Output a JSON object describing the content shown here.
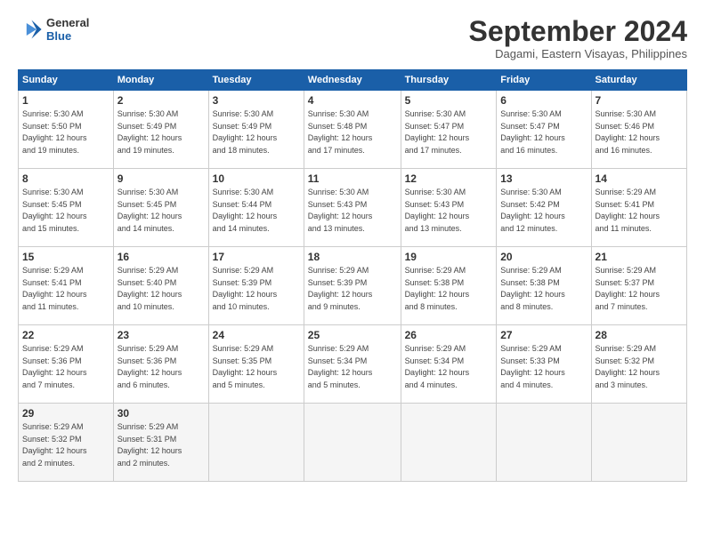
{
  "header": {
    "logo_line1": "General",
    "logo_line2": "Blue",
    "month_title": "September 2024",
    "location": "Dagami, Eastern Visayas, Philippines"
  },
  "weekdays": [
    "Sunday",
    "Monday",
    "Tuesday",
    "Wednesday",
    "Thursday",
    "Friday",
    "Saturday"
  ],
  "weeks": [
    [
      {
        "day": "1",
        "sunrise": "5:30 AM",
        "sunset": "5:50 PM",
        "daylight": "12 hours and 19 minutes."
      },
      {
        "day": "2",
        "sunrise": "5:30 AM",
        "sunset": "5:49 PM",
        "daylight": "12 hours and 19 minutes."
      },
      {
        "day": "3",
        "sunrise": "5:30 AM",
        "sunset": "5:49 PM",
        "daylight": "12 hours and 18 minutes."
      },
      {
        "day": "4",
        "sunrise": "5:30 AM",
        "sunset": "5:48 PM",
        "daylight": "12 hours and 17 minutes."
      },
      {
        "day": "5",
        "sunrise": "5:30 AM",
        "sunset": "5:47 PM",
        "daylight": "12 hours and 17 minutes."
      },
      {
        "day": "6",
        "sunrise": "5:30 AM",
        "sunset": "5:47 PM",
        "daylight": "12 hours and 16 minutes."
      },
      {
        "day": "7",
        "sunrise": "5:30 AM",
        "sunset": "5:46 PM",
        "daylight": "12 hours and 16 minutes."
      }
    ],
    [
      {
        "day": "8",
        "sunrise": "5:30 AM",
        "sunset": "5:45 PM",
        "daylight": "12 hours and 15 minutes."
      },
      {
        "day": "9",
        "sunrise": "5:30 AM",
        "sunset": "5:45 PM",
        "daylight": "12 hours and 14 minutes."
      },
      {
        "day": "10",
        "sunrise": "5:30 AM",
        "sunset": "5:44 PM",
        "daylight": "12 hours and 14 minutes."
      },
      {
        "day": "11",
        "sunrise": "5:30 AM",
        "sunset": "5:43 PM",
        "daylight": "12 hours and 13 minutes."
      },
      {
        "day": "12",
        "sunrise": "5:30 AM",
        "sunset": "5:43 PM",
        "daylight": "12 hours and 13 minutes."
      },
      {
        "day": "13",
        "sunrise": "5:30 AM",
        "sunset": "5:42 PM",
        "daylight": "12 hours and 12 minutes."
      },
      {
        "day": "14",
        "sunrise": "5:29 AM",
        "sunset": "5:41 PM",
        "daylight": "12 hours and 11 minutes."
      }
    ],
    [
      {
        "day": "15",
        "sunrise": "5:29 AM",
        "sunset": "5:41 PM",
        "daylight": "12 hours and 11 minutes."
      },
      {
        "day": "16",
        "sunrise": "5:29 AM",
        "sunset": "5:40 PM",
        "daylight": "12 hours and 10 minutes."
      },
      {
        "day": "17",
        "sunrise": "5:29 AM",
        "sunset": "5:39 PM",
        "daylight": "12 hours and 10 minutes."
      },
      {
        "day": "18",
        "sunrise": "5:29 AM",
        "sunset": "5:39 PM",
        "daylight": "12 hours and 9 minutes."
      },
      {
        "day": "19",
        "sunrise": "5:29 AM",
        "sunset": "5:38 PM",
        "daylight": "12 hours and 8 minutes."
      },
      {
        "day": "20",
        "sunrise": "5:29 AM",
        "sunset": "5:38 PM",
        "daylight": "12 hours and 8 minutes."
      },
      {
        "day": "21",
        "sunrise": "5:29 AM",
        "sunset": "5:37 PM",
        "daylight": "12 hours and 7 minutes."
      }
    ],
    [
      {
        "day": "22",
        "sunrise": "5:29 AM",
        "sunset": "5:36 PM",
        "daylight": "12 hours and 7 minutes."
      },
      {
        "day": "23",
        "sunrise": "5:29 AM",
        "sunset": "5:36 PM",
        "daylight": "12 hours and 6 minutes."
      },
      {
        "day": "24",
        "sunrise": "5:29 AM",
        "sunset": "5:35 PM",
        "daylight": "12 hours and 5 minutes."
      },
      {
        "day": "25",
        "sunrise": "5:29 AM",
        "sunset": "5:34 PM",
        "daylight": "12 hours and 5 minutes."
      },
      {
        "day": "26",
        "sunrise": "5:29 AM",
        "sunset": "5:34 PM",
        "daylight": "12 hours and 4 minutes."
      },
      {
        "day": "27",
        "sunrise": "5:29 AM",
        "sunset": "5:33 PM",
        "daylight": "12 hours and 4 minutes."
      },
      {
        "day": "28",
        "sunrise": "5:29 AM",
        "sunset": "5:32 PM",
        "daylight": "12 hours and 3 minutes."
      }
    ],
    [
      {
        "day": "29",
        "sunrise": "5:29 AM",
        "sunset": "5:32 PM",
        "daylight": "12 hours and 2 minutes."
      },
      {
        "day": "30",
        "sunrise": "5:29 AM",
        "sunset": "5:31 PM",
        "daylight": "12 hours and 2 minutes."
      },
      null,
      null,
      null,
      null,
      null
    ]
  ],
  "labels": {
    "sunrise": "Sunrise:",
    "sunset": "Sunset:",
    "daylight": "Daylight:"
  }
}
